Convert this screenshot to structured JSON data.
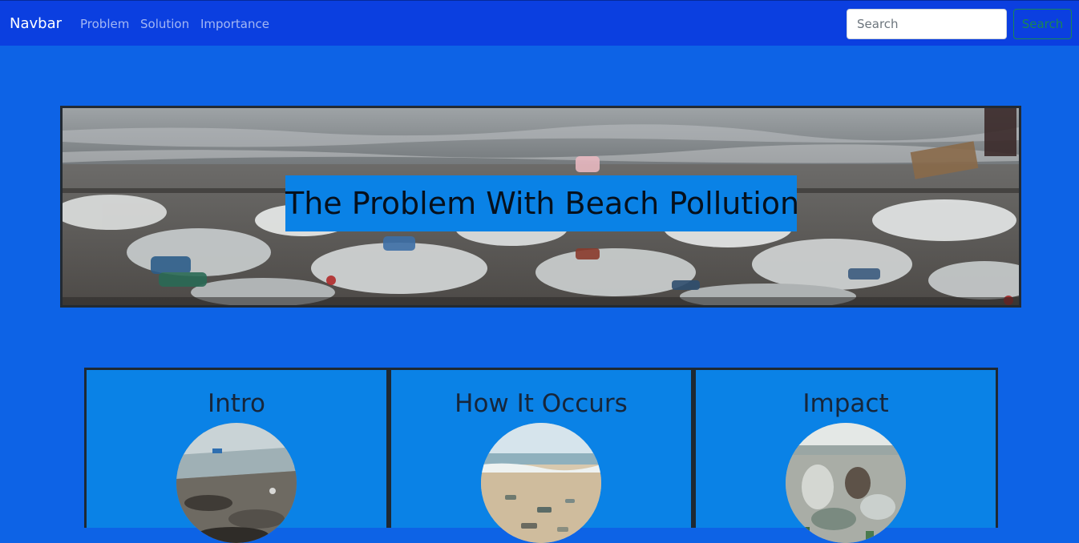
{
  "navbar": {
    "brand": "Navbar",
    "links": [
      "Problem",
      "Solution",
      "Importance"
    ],
    "search_placeholder": "Search",
    "search_button": "Search"
  },
  "hero": {
    "title": "The Problem With Beach Pollution"
  },
  "cards": [
    {
      "title": "Intro"
    },
    {
      "title": "How It Occurs"
    },
    {
      "title": "Impact"
    }
  ],
  "colors": {
    "page_background": "#0d63e6",
    "navbar_background": "#0b3fe0",
    "panel_blue": "#0a82e6",
    "border_dark": "#1e2933",
    "search_button_green": "#198754"
  }
}
